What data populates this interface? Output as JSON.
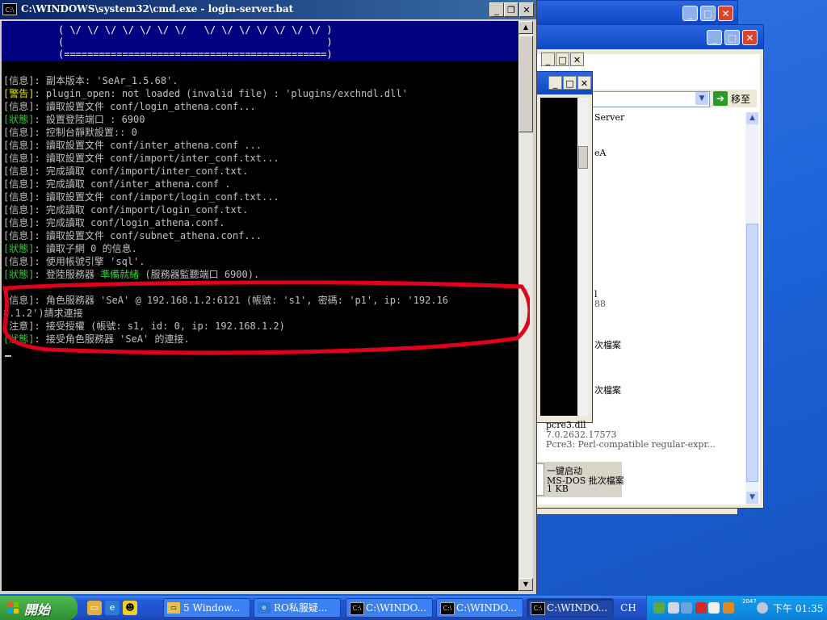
{
  "cmd_window": {
    "title": "C:\\WINDOWS\\system32\\cmd.exe - login-server.bat",
    "icon_text": "C:\\",
    "min_glyph": "_",
    "max_glyph": "❐",
    "close_glyph": "✕"
  },
  "banner": [
    "( \\/ \\/ \\/ \\/ \\/ \\/ \\/   \\/ \\/ \\/ \\/ \\/ \\/ \\/ )",
    "(                                             )",
    "(=============================================)"
  ],
  "console_lines": [
    {
      "tag": "[信息]",
      "kind": "info",
      "text": ": 副本版本: 'SeAr_1.5.68'."
    },
    {
      "tag": "[警告]",
      "kind": "warn",
      "text": ": plugin_open: not loaded (invalid file) : 'plugins/exchndl.dll'"
    },
    {
      "tag": "[信息]",
      "kind": "info",
      "text": ": 讀取設置文件 conf/login_athena.conf..."
    },
    {
      "tag": "[狀態]",
      "kind": "status",
      "text": ": 設置登陸端口 : 6900"
    },
    {
      "tag": "[信息]",
      "kind": "info",
      "text": ": 控制台靜默設置:: 0"
    },
    {
      "tag": "[信息]",
      "kind": "info",
      "text": ": 讀取設置文件 conf/inter_athena.conf ..."
    },
    {
      "tag": "[信息]",
      "kind": "info",
      "text": ": 讀取設置文件 conf/import/inter_conf.txt..."
    },
    {
      "tag": "[信息]",
      "kind": "info",
      "text": ": 完成讀取 conf/import/inter_conf.txt."
    },
    {
      "tag": "[信息]",
      "kind": "info",
      "text": ": 完成讀取 conf/inter_athena.conf ."
    },
    {
      "tag": "[信息]",
      "kind": "info",
      "text": ": 讀取設置文件 conf/import/login_conf.txt..."
    },
    {
      "tag": "[信息]",
      "kind": "info",
      "text": ": 完成讀取 conf/import/login_conf.txt."
    },
    {
      "tag": "[信息]",
      "kind": "info",
      "text": ": 完成讀取 conf/login_athena.conf."
    },
    {
      "tag": "[信息]",
      "kind": "info",
      "text": ": 讀取設置文件 conf/subnet_athena.conf..."
    },
    {
      "tag": "[狀態]",
      "kind": "status",
      "text": ": 讀取子網 0 的信息."
    },
    {
      "tag": "[信息]",
      "kind": "info",
      "text": ": 使用帳號引擎 'sql'."
    },
    {
      "tag": "[狀態]",
      "kind": "status",
      "text": ": 登陸服務器 ",
      "highlight": "準備就緒",
      "after": " (服務器監聽端口 6900)."
    }
  ],
  "console_lines_2": [
    {
      "tag": "[信息]",
      "kind": "info",
      "text": ": 角色服務器 'SeA' @ 192.168.1.2:6121 (帳號: 's1', 密碼: 'p1', ip: '192.16"
    },
    {
      "tag": "",
      "kind": "info",
      "text": "8.1.2')請求連接"
    },
    {
      "tag": "[注意]",
      "kind": "info",
      "text": ": 接受授權 (帳號: s1, id: 0, ip: 192.168.1.2)"
    },
    {
      "tag": "[狀態]",
      "kind": "status",
      "text": ": 接受角色服務器 'SeA' 的連接."
    }
  ],
  "annotation": {
    "color": "#e0001a"
  },
  "background_window": {
    "go_label": "移至",
    "fragments": [
      "Server",
      "eA",
      "l",
      "88",
      "次檔案",
      "次檔案"
    ],
    "file1": {
      "name": "pcre3.dll",
      "version": "7.0.2632.17573",
      "desc": "Pcre3: Perl-compatible regular-expr..."
    },
    "file2": {
      "name": "一键启动",
      "type": "MS-DOS 批次檔案",
      "size": "1 KB"
    }
  },
  "taskbar": {
    "start_label": "開始",
    "quick_launch": [
      "folder-icon",
      "ie-icon",
      "qq-icon"
    ],
    "buttons": [
      {
        "label": "5 Window...",
        "icon": "folder-group-icon",
        "active": false
      },
      {
        "label": "RO私服疑...",
        "icon": "ie-icon",
        "active": false
      },
      {
        "label": "C:\\WINDO...",
        "icon": "cmd-icon",
        "active": false
      },
      {
        "label": "C:\\WINDO...",
        "icon": "cmd-icon",
        "active": false
      },
      {
        "label": "C:\\WINDO...",
        "icon": "cmd-icon",
        "active": true
      }
    ],
    "language": "CH",
    "network_speed": "2047",
    "clock": "下午 01:35"
  },
  "colors": {
    "console_bg": "#000000",
    "banner_bg": "#000080",
    "info": "#c0c0c0",
    "warn": "#e8e800",
    "status": "#32d232"
  }
}
